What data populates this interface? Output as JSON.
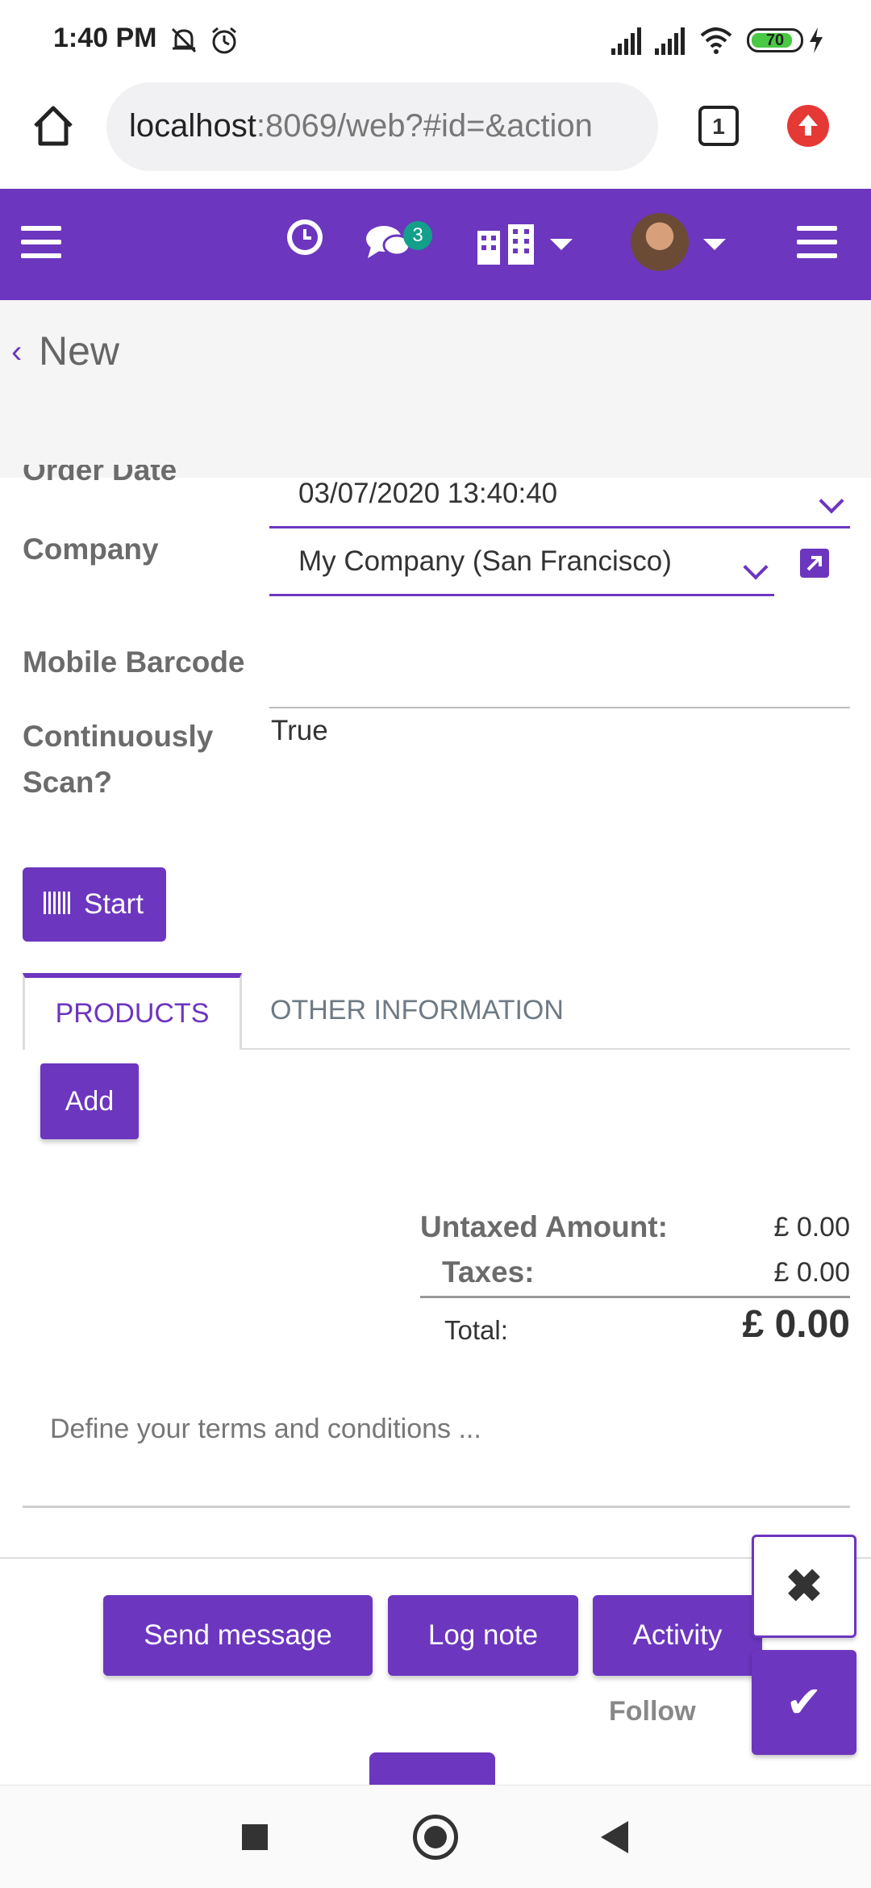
{
  "status_bar": {
    "time": "1:40 PM",
    "battery_level": "70"
  },
  "browser": {
    "url_host": "localhost",
    "url_rest": ":8069/web?#id=&action",
    "tab_count": "1"
  },
  "nav": {
    "message_count": "3"
  },
  "breadcrumb": {
    "back_glyph": "‹",
    "title": "New"
  },
  "form": {
    "order_date": {
      "label": "Order Date",
      "value": "03/07/2020 13:40:40"
    },
    "company": {
      "label": "Company",
      "value": "My Company (San Francisco)"
    },
    "mobile_barcode": {
      "label": "Mobile Barcode",
      "value": ""
    },
    "continuously_scan": {
      "label_line1": "Continuously",
      "label_line2": "Scan?",
      "value": "True"
    },
    "start_label": "Start"
  },
  "tabs": [
    {
      "label": "PRODUCTS",
      "active": true
    },
    {
      "label": "OTHER INFORMATION",
      "active": false
    }
  ],
  "add_label": "Add",
  "totals": {
    "untaxed_label": "Untaxed Amount:",
    "untaxed_value": "£ 0.00",
    "taxes_label": "Taxes:",
    "taxes_value": "£ 0.00",
    "total_label": "Total:",
    "total_value": "£ 0.00"
  },
  "terms_placeholder": "Define your terms and conditions ...",
  "chatter": {
    "send_message": "Send message",
    "log_note": "Log note",
    "activity": "Activity",
    "follow": "Follow"
  },
  "actions": {
    "discard_glyph": "✖",
    "save_glyph": "✔"
  },
  "colors": {
    "primary": "#6c36bf",
    "badge": "#139f8a",
    "alert": "#e53935"
  }
}
